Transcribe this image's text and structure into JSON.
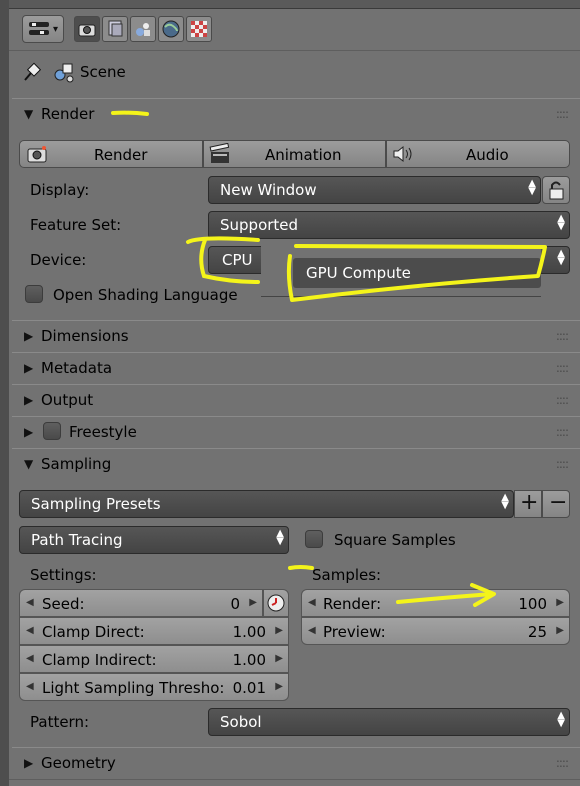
{
  "header": {
    "scene_label": "Scene"
  },
  "render_panel": {
    "title": "Render",
    "tabs": [
      {
        "label": "Render",
        "icon": "camera-icon"
      },
      {
        "label": "Animation",
        "icon": "clapper-icon"
      },
      {
        "label": "Audio",
        "icon": "speaker-icon"
      }
    ],
    "display": {
      "label": "Display:",
      "value": "New Window"
    },
    "feature_set": {
      "label": "Feature Set:",
      "value": "Supported"
    },
    "device": {
      "label": "Device:",
      "value": "CPU",
      "dropdown_option": "GPU Compute"
    },
    "open_shading_language": {
      "label": "Open Shading Language",
      "checked": false
    }
  },
  "collapsed_panels": [
    "Dimensions",
    "Metadata",
    "Output",
    "Freestyle"
  ],
  "sampling_panel": {
    "title": "Sampling",
    "presets": {
      "label": "Sampling Presets"
    },
    "integrator": {
      "value": "Path Tracing"
    },
    "square_samples": {
      "label": "Square Samples",
      "checked": false
    },
    "settings_label": "Settings:",
    "samples_label": "Samples:",
    "seed": {
      "label": "Seed:",
      "value": "0"
    },
    "clamp_direct": {
      "label": "Clamp Direct:",
      "value": "1.00"
    },
    "clamp_indirect": {
      "label": "Clamp Indirect:",
      "value": "1.00"
    },
    "light_threshold": {
      "label": "Light Sampling Thresho:",
      "value": "0.01"
    },
    "render_samples": {
      "label": "Render:",
      "value": "100"
    },
    "preview_samples": {
      "label": "Preview:",
      "value": "25"
    },
    "pattern": {
      "label": "Pattern:",
      "value": "Sobol"
    }
  },
  "geometry_panel": {
    "title": "Geometry"
  },
  "colors": {
    "annotation_yellow": "#f4f41a",
    "panel_bg": "#727272",
    "dark_field": "#4a4a4a"
  }
}
